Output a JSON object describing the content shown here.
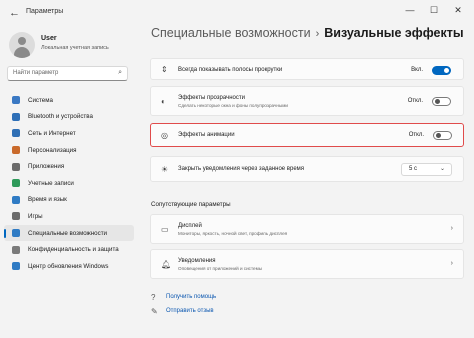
{
  "window": {
    "title": "Параметры",
    "minimize": "—",
    "maximize": "☐",
    "close": "✕"
  },
  "user": {
    "name": "User",
    "account_type": "Локальная учетная запись"
  },
  "search": {
    "placeholder": "Найти параметр"
  },
  "nav": {
    "items": [
      {
        "label": "Система",
        "icon": "monitor-icon",
        "color": "#3a78c3"
      },
      {
        "label": "Bluetooth и устройства",
        "icon": "bluetooth-icon",
        "color": "#2e6fb7"
      },
      {
        "label": "Сеть и Интернет",
        "icon": "wifi-icon",
        "color": "#2f6fb5"
      },
      {
        "label": "Персонализация",
        "icon": "brush-icon",
        "color": "#c96a2b"
      },
      {
        "label": "Приложения",
        "icon": "apps-icon",
        "color": "#6b6b6b"
      },
      {
        "label": "Учетные записи",
        "icon": "person-icon",
        "color": "#2e9a5a"
      },
      {
        "label": "Время и язык",
        "icon": "globe-icon",
        "color": "#2f7bc4"
      },
      {
        "label": "Игры",
        "icon": "gamepad-icon",
        "color": "#6b6b6b"
      },
      {
        "label": "Специальные возможности",
        "icon": "accessibility-icon",
        "color": "#2f7bc4"
      },
      {
        "label": "Конфиденциальность и защита",
        "icon": "shield-icon",
        "color": "#7a7a7a"
      },
      {
        "label": "Центр обновления Windows",
        "icon": "update-icon",
        "color": "#2f7bc4"
      }
    ],
    "active_index": 8
  },
  "breadcrumb": {
    "parent": "Специальные возможности",
    "separator": "›",
    "current": "Визуальные эффекты"
  },
  "settings": {
    "scrollbars": {
      "title": "Всегда показывать полосы прокрутки",
      "state_label": "Вкл.",
      "on": true,
      "icon": "scrollbar-icon"
    },
    "transparency": {
      "title": "Эффекты прозрачности",
      "subtitle": "Сделать некоторые окна и фоны полупрозрачными",
      "state_label": "Откл.",
      "on": false,
      "icon": "transparency-icon"
    },
    "animation": {
      "title": "Эффекты анимации",
      "state_label": "Откл.",
      "on": false,
      "icon": "animation-icon"
    },
    "notifications_timeout": {
      "title": "Закрыть уведомления через заданное время",
      "value": "5 с",
      "icon": "sun-icon"
    }
  },
  "related": {
    "section_title": "Сопутствующие параметры",
    "display": {
      "title": "Дисплей",
      "subtitle": "Мониторы, яркость, ночной свет, профиль дисплея"
    },
    "notifications": {
      "title": "Уведомления",
      "subtitle": "Оповещения от приложений и системы"
    }
  },
  "links": {
    "help": "Получить помощь",
    "feedback": "Отправить отзыв"
  },
  "colors": {
    "accent": "#0067c0",
    "highlight_border": "#e04b4b",
    "link": "#0b57b0"
  }
}
